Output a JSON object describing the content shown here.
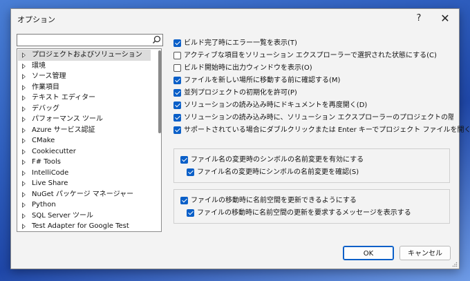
{
  "window": {
    "title": "オプション",
    "help_label": "?",
    "close_label": "✕"
  },
  "search": {
    "value": "",
    "placeholder": ""
  },
  "tree": {
    "items": [
      {
        "label": "プロジェクトおよびソリューション",
        "selected": true
      },
      {
        "label": "環境"
      },
      {
        "label": "ソース管理"
      },
      {
        "label": "作業項目"
      },
      {
        "label": "テキスト エディター"
      },
      {
        "label": "デバッグ"
      },
      {
        "label": "パフォーマンス ツール"
      },
      {
        "label": "Azure サービス認証"
      },
      {
        "label": "CMake"
      },
      {
        "label": "Cookiecutter"
      },
      {
        "label": "F# Tools"
      },
      {
        "label": "IntelliCode"
      },
      {
        "label": "Live Share"
      },
      {
        "label": "NuGet パッケージ マネージャー"
      },
      {
        "label": "Python"
      },
      {
        "label": "SQL Server ツール"
      },
      {
        "label": "Test Adapter for Google Test"
      }
    ]
  },
  "options": [
    {
      "label": "ビルド完了時にエラー一覧を表示(T)",
      "checked": true
    },
    {
      "label": "アクティブな項目をソリューション エクスプローラーで選択された状態にする(C)",
      "checked": false
    },
    {
      "label": "ビルド開始時に出力ウィンドウを表示(O)",
      "checked": false
    },
    {
      "label": "ファイルを新しい場所に移動する前に確認する(M)",
      "checked": true
    },
    {
      "label": "並列プロジェクトの初期化を許可(P)",
      "checked": true
    },
    {
      "label": "ソリューションの読み込み時にドキュメントを再度開く(D)",
      "checked": true
    },
    {
      "label": "ソリューションの読み込み時に、ソリューション エクスプローラーのプロジェクトの階層状態を復元する",
      "checked": true
    },
    {
      "label": "サポートされている場合にダブルクリックまたは Enter キーでプロジェクト ファイルを開く(F)",
      "checked": true
    }
  ],
  "rename_group": {
    "enable": {
      "label": "ファイル名の変更時のシンボルの名前変更を有効にする",
      "checked": true
    },
    "confirm": {
      "label": "ファイル名の変更時にシンボルの名前変更を確認(S)",
      "checked": true
    }
  },
  "namespace_group": {
    "update": {
      "label": "ファイルの移動時に名前空間を更新できるようにする",
      "checked": true
    },
    "message": {
      "label": "ファイルの移動時に名前空間の更新を要求するメッセージを表示する",
      "checked": true
    }
  },
  "buttons": {
    "ok": "OK",
    "cancel": "キャンセル"
  },
  "colors": {
    "accent": "#0a5fc8",
    "window_bg": "#f3f3f3",
    "selection": "#dcdcdc"
  }
}
